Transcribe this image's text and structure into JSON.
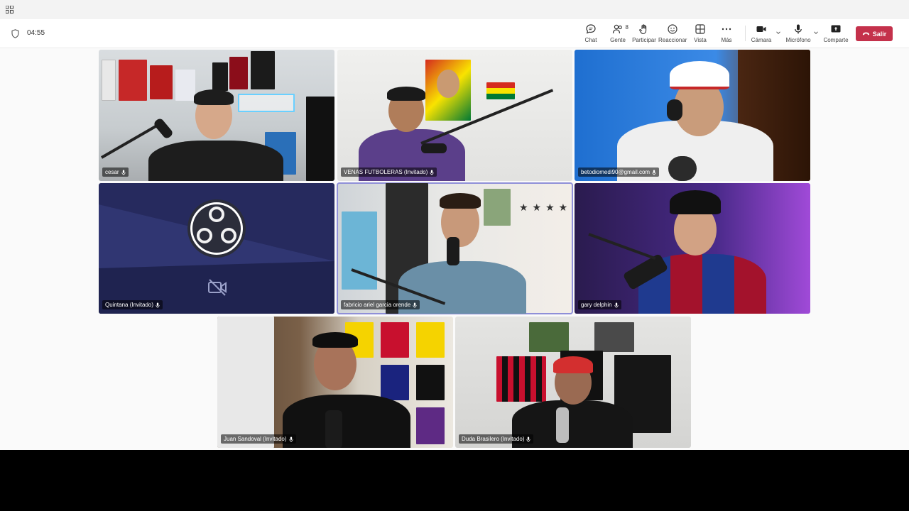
{
  "meeting": {
    "timer": "04:55"
  },
  "toolbar": {
    "chat_label": "Chat",
    "people_label": "Gente",
    "people_count": "8",
    "raise_hand_label": "Participar",
    "react_label": "Reaccionar",
    "view_label": "Vista",
    "more_label": "Más",
    "camera_label": "Cámara",
    "mic_label": "Micrófono",
    "share_label": "Comparte",
    "leave_label": "Salir"
  },
  "participants": [
    {
      "name": "cesar"
    },
    {
      "name": "VENAS FUTBOLERAS (Invitado)"
    },
    {
      "name": "betodiomedi90@gmail.com"
    },
    {
      "name": "Quintana (Invitado)"
    },
    {
      "name": "fabricio ariel garcia orende"
    },
    {
      "name": "gary delphin"
    },
    {
      "name": "Juan Sandoval (Invitado)"
    },
    {
      "name": "Duda Brasilero (Invitado)"
    }
  ],
  "colors": {
    "leave_button": "#c4314b",
    "active_speaker_border": "#8f8fd8"
  }
}
